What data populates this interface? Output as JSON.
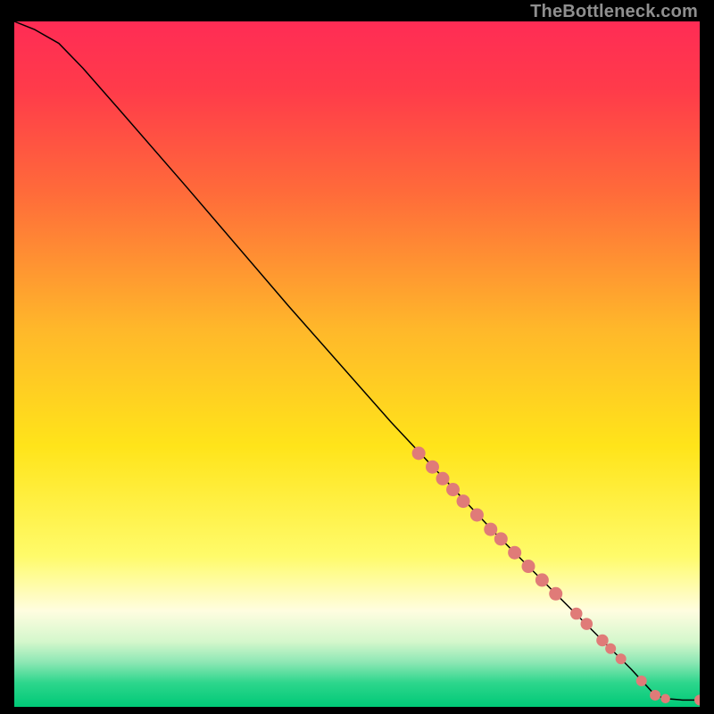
{
  "attribution": "TheBottleneck.com",
  "chart_data": {
    "type": "line",
    "title": "",
    "xlabel": "",
    "ylabel": "",
    "xlim": [
      0,
      100
    ],
    "ylim": [
      0,
      100
    ],
    "grid": false,
    "gradient_stops": [
      {
        "offset": 0.0,
        "color": "#ff2c55"
      },
      {
        "offset": 0.1,
        "color": "#ff3b4a"
      },
      {
        "offset": 0.25,
        "color": "#ff6b3a"
      },
      {
        "offset": 0.45,
        "color": "#ffb82a"
      },
      {
        "offset": 0.62,
        "color": "#ffe41a"
      },
      {
        "offset": 0.78,
        "color": "#fffb6a"
      },
      {
        "offset": 0.86,
        "color": "#fffde0"
      },
      {
        "offset": 0.905,
        "color": "#d4f7cc"
      },
      {
        "offset": 0.935,
        "color": "#8de7b4"
      },
      {
        "offset": 0.965,
        "color": "#2dd68c"
      },
      {
        "offset": 1.0,
        "color": "#00c977"
      }
    ],
    "line_points": [
      {
        "x": 0.0,
        "y": 100.0
      },
      {
        "x": 3.0,
        "y": 98.8
      },
      {
        "x": 6.5,
        "y": 96.8
      },
      {
        "x": 10.0,
        "y": 93.2
      },
      {
        "x": 15.0,
        "y": 87.5
      },
      {
        "x": 25.0,
        "y": 76.0
      },
      {
        "x": 40.0,
        "y": 58.5
      },
      {
        "x": 55.0,
        "y": 41.5
      },
      {
        "x": 70.0,
        "y": 25.5
      },
      {
        "x": 85.0,
        "y": 10.5
      },
      {
        "x": 90.0,
        "y": 5.5
      },
      {
        "x": 93.5,
        "y": 1.7
      },
      {
        "x": 95.0,
        "y": 1.2
      },
      {
        "x": 97.5,
        "y": 1.0
      },
      {
        "x": 100.0,
        "y": 1.0
      }
    ],
    "markers": [
      {
        "x": 59.0,
        "y": 37.0,
        "r": 1.0
      },
      {
        "x": 61.0,
        "y": 35.0,
        "r": 1.0
      },
      {
        "x": 62.5,
        "y": 33.3,
        "r": 1.0
      },
      {
        "x": 64.0,
        "y": 31.7,
        "r": 1.0
      },
      {
        "x": 65.5,
        "y": 30.0,
        "r": 1.0
      },
      {
        "x": 67.5,
        "y": 28.0,
        "r": 1.0
      },
      {
        "x": 69.5,
        "y": 25.9,
        "r": 1.0
      },
      {
        "x": 71.0,
        "y": 24.5,
        "r": 1.0
      },
      {
        "x": 73.0,
        "y": 22.5,
        "r": 1.0
      },
      {
        "x": 75.0,
        "y": 20.5,
        "r": 1.0
      },
      {
        "x": 77.0,
        "y": 18.5,
        "r": 1.0
      },
      {
        "x": 79.0,
        "y": 16.5,
        "r": 1.0
      },
      {
        "x": 82.0,
        "y": 13.6,
        "r": 0.9
      },
      {
        "x": 83.5,
        "y": 12.1,
        "r": 0.9
      },
      {
        "x": 85.8,
        "y": 9.7,
        "r": 0.9
      },
      {
        "x": 87.0,
        "y": 8.5,
        "r": 0.8
      },
      {
        "x": 88.5,
        "y": 7.0,
        "r": 0.8
      },
      {
        "x": 91.5,
        "y": 3.8,
        "r": 0.8
      },
      {
        "x": 93.5,
        "y": 1.7,
        "r": 0.8
      },
      {
        "x": 95.0,
        "y": 1.2,
        "r": 0.7
      },
      {
        "x": 100.0,
        "y": 1.0,
        "r": 0.8
      }
    ],
    "marker_color": "#e07b78",
    "line_color": "#000000",
    "line_width": 1.5
  }
}
